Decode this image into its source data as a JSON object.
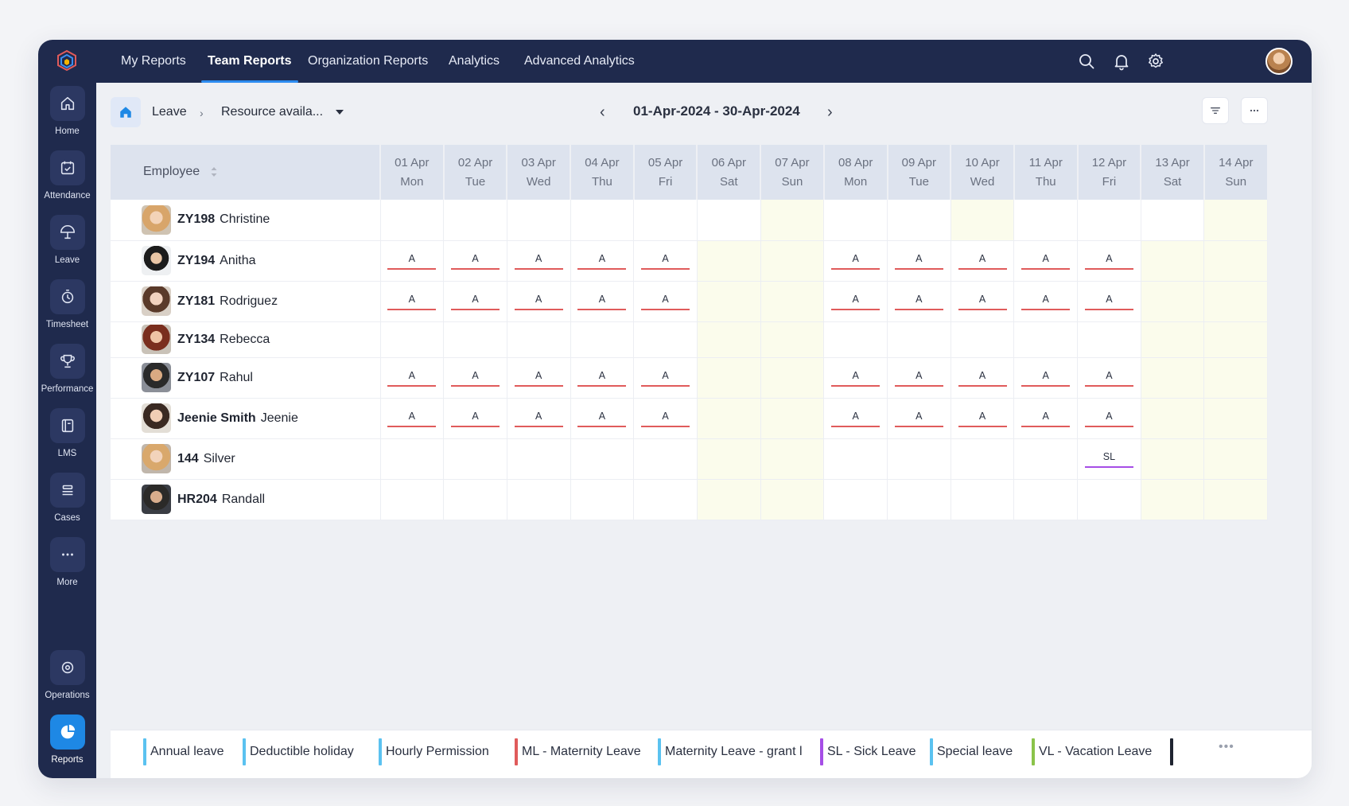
{
  "colors": {
    "sidebar": "#1f2a4d",
    "accent": "#1e88e5",
    "absent": "#e05b5b",
    "sick": "#a64ee6",
    "weekend": "#fbfcec"
  },
  "sidebar": {
    "items": [
      {
        "label": "Home",
        "icon": "home-icon"
      },
      {
        "label": "Attendance",
        "icon": "calendar-check-icon"
      },
      {
        "label": "Leave",
        "icon": "umbrella-icon"
      },
      {
        "label": "Timesheet",
        "icon": "timer-icon"
      },
      {
        "label": "Performance",
        "icon": "trophy-icon"
      },
      {
        "label": "LMS",
        "icon": "book-icon"
      },
      {
        "label": "Cases",
        "icon": "stack-icon"
      },
      {
        "label": "More",
        "icon": "more-dots-icon"
      },
      {
        "label": "Operations",
        "icon": "operations-icon"
      },
      {
        "label": "Reports",
        "icon": "pie-chart-icon"
      }
    ]
  },
  "topnav": {
    "tabs": [
      "My Reports",
      "Team Reports",
      "Organization Reports",
      "Analytics",
      "Advanced Analytics"
    ],
    "active": "Team Reports"
  },
  "toolbar": {
    "crumb_module": "Leave",
    "crumb_report": "Resource availa...",
    "date_range": "01-Apr-2024 - 30-Apr-2024",
    "prev": "‹",
    "next": "›"
  },
  "table": {
    "employee_header": "Employee",
    "days": [
      {
        "date": "01 Apr",
        "day": "Mon"
      },
      {
        "date": "02 Apr",
        "day": "Tue"
      },
      {
        "date": "03 Apr",
        "day": "Wed"
      },
      {
        "date": "04 Apr",
        "day": "Thu"
      },
      {
        "date": "05 Apr",
        "day": "Fri"
      },
      {
        "date": "06 Apr",
        "day": "Sat"
      },
      {
        "date": "07 Apr",
        "day": "Sun"
      },
      {
        "date": "08 Apr",
        "day": "Mon"
      },
      {
        "date": "09 Apr",
        "day": "Tue"
      },
      {
        "date": "10 Apr",
        "day": "Wed"
      },
      {
        "date": "11 Apr",
        "day": "Thu"
      },
      {
        "date": "12 Apr",
        "day": "Fri"
      },
      {
        "date": "13 Apr",
        "day": "Sat"
      },
      {
        "date": "14 Apr",
        "day": "Sun"
      }
    ],
    "rows": [
      {
        "id": "ZY198",
        "name": "Christine",
        "cells": [
          "",
          "",
          "",
          "",
          "",
          "",
          "",
          "",
          "",
          "",
          "",
          "",
          "",
          ""
        ]
      },
      {
        "id": "ZY194",
        "name": "Anitha",
        "cells": [
          "A",
          "A",
          "A",
          "A",
          "A",
          "",
          "",
          "A",
          "A",
          "A",
          "A",
          "A",
          "",
          ""
        ]
      },
      {
        "id": "ZY181",
        "name": "Rodriguez",
        "cells": [
          "A",
          "A",
          "A",
          "A",
          "A",
          "",
          "",
          "A",
          "A",
          "A",
          "A",
          "A",
          "",
          ""
        ]
      },
      {
        "id": "ZY134",
        "name": "Rebecca",
        "cells": [
          "",
          "",
          "",
          "",
          "",
          "",
          "",
          "",
          "",
          "",
          "",
          "",
          "",
          ""
        ]
      },
      {
        "id": "ZY107",
        "name": "Rahul",
        "cells": [
          "A",
          "A",
          "A",
          "A",
          "A",
          "",
          "",
          "A",
          "A",
          "A",
          "A",
          "A",
          "",
          ""
        ]
      },
      {
        "id": "Jeenie Smith",
        "name": "Jeenie",
        "cells": [
          "A",
          "A",
          "A",
          "A",
          "A",
          "",
          "",
          "A",
          "A",
          "A",
          "A",
          "A",
          "",
          ""
        ]
      },
      {
        "id": "144",
        "name": "Silver",
        "cells": [
          "",
          "",
          "",
          "",
          "",
          "",
          "",
          "",
          "",
          "",
          "",
          "SL",
          "",
          ""
        ]
      },
      {
        "id": "HR204",
        "name": "Randall",
        "cells": [
          "",
          "",
          "",
          "",
          "",
          "",
          "",
          "",
          "",
          "",
          "",
          "",
          "",
          ""
        ]
      }
    ]
  },
  "legend": [
    {
      "label": "Annual leave",
      "color": "#5bc2f0"
    },
    {
      "label": "Deductible holiday",
      "color": "#5bc2f0"
    },
    {
      "label": "Hourly Permission",
      "color": "#5bc2f0"
    },
    {
      "label": "ML - Maternity Leave",
      "color": "#e05b5b"
    },
    {
      "label": "Maternity Leave - grant l",
      "color": "#5bc2f0"
    },
    {
      "label": "SL - Sick Leave",
      "color": "#a64ee6"
    },
    {
      "label": "Special leave",
      "color": "#5bc2f0"
    },
    {
      "label": "VL - Vacation Leave",
      "color": "#8bc34a"
    },
    {
      "label": "",
      "color": "#1f2430"
    }
  ],
  "legend_more": "•••"
}
